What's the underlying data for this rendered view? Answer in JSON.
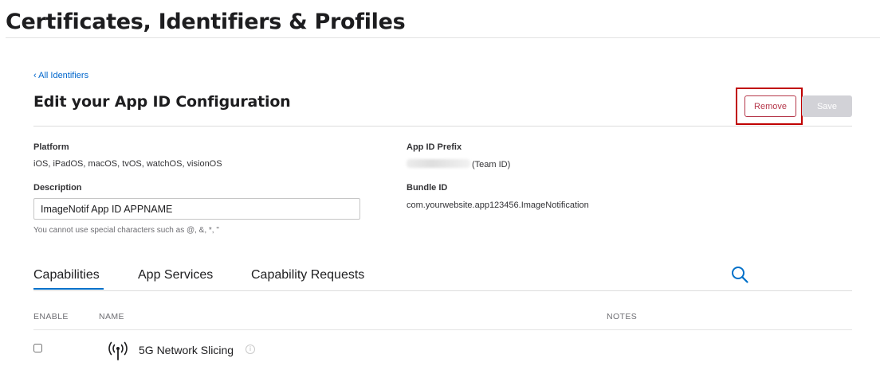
{
  "header": {
    "title": "Certificates, Identifiers & Profiles"
  },
  "nav": {
    "back_link": "‹ All Identifiers"
  },
  "section": {
    "title": "Edit your App ID Configuration",
    "remove_label": "Remove",
    "save_label": "Save"
  },
  "fields": {
    "platform_label": "Platform",
    "platform_value": "iOS, iPadOS, macOS, tvOS, watchOS, visionOS",
    "prefix_label": "App ID Prefix",
    "prefix_suffix": "(Team ID)",
    "description_label": "Description",
    "description_value": "ImageNotif App ID APPNAME",
    "description_hint": "You cannot use special characters such as @, &, *, \"",
    "bundle_label": "Bundle ID",
    "bundle_value": "com.yourwebsite.app123456.ImageNotification"
  },
  "tabs": [
    {
      "label": "Capabilities",
      "active": true
    },
    {
      "label": "App Services",
      "active": false
    },
    {
      "label": "Capability Requests",
      "active": false
    }
  ],
  "table": {
    "columns": [
      "ENABLE",
      "NAME",
      "NOTES"
    ],
    "rows": [
      {
        "name": "5G Network Slicing",
        "enabled": false,
        "icon": "antenna-signal-icon",
        "info": "i"
      }
    ]
  },
  "colors": {
    "accent": "#0070c9",
    "link": "#0066cc",
    "remove": "#b5374a",
    "save_disabled": "#d2d2d7",
    "highlight": "#c00000"
  }
}
